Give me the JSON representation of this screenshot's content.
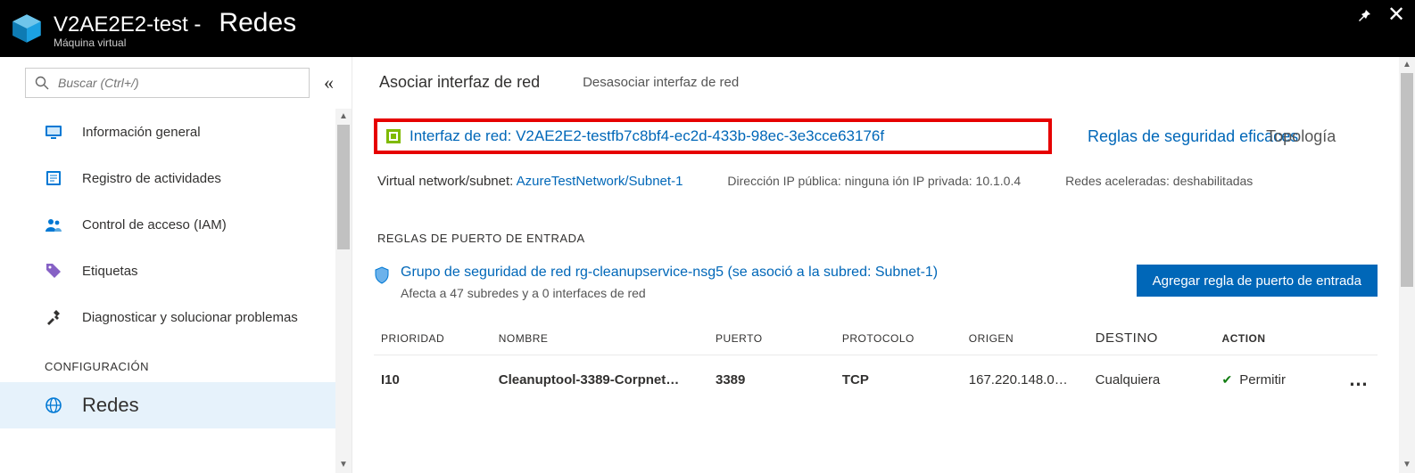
{
  "header": {
    "title_resource": "V2AE2E2-test -",
    "title_section": "Redes",
    "subtitle": "Máquina virtual"
  },
  "sidebar": {
    "search_placeholder": "Buscar (Ctrl+/)",
    "items": [
      {
        "label": "Información general",
        "icon": "monitor"
      },
      {
        "label": "Registro de actividades",
        "icon": "log"
      },
      {
        "label": "Control de acceso (IAM)",
        "icon": "people"
      },
      {
        "label": "Etiquetas",
        "icon": "tag"
      },
      {
        "label": "Diagnosticar y solucionar problemas",
        "icon": "tools"
      }
    ],
    "section_label": "CONFIGURACIÓN",
    "active_item": {
      "label": "Redes",
      "icon": "network"
    }
  },
  "tabs": {
    "associate": "Asociar interfaz de red",
    "dissociate": "Desasociar interfaz de red"
  },
  "nic": {
    "label": "Interfaz de red:",
    "name": "V2AE2E2-testfb7c8bf4-ec2d-433b-98ec-3e3cce63176f"
  },
  "right_links": {
    "effective_rules": "Reglas de seguridad eficaces",
    "topology": "Topología"
  },
  "info": {
    "vnet_label": "Virtual network/subnet:",
    "vnet_value": "AzureTestNetwork/Subnet-1",
    "public_ip_label": "Dirección IP pública:",
    "public_ip_value": "ninguna",
    "private_ip_label": "IP privada:",
    "private_ip_value": "10.1.0.4",
    "accel_label": "Redes  aceleradas:",
    "accel_value": "deshabilitadas"
  },
  "rules": {
    "section_title": "REGLAS DE PUERTO DE ENTRADA",
    "nsg_link": "Grupo de seguridad de red rg-cleanupservice-nsg5 (se asoció a la subred: Subnet-1)",
    "nsg_sub": "Afecta a 47 subredes y a 0 interfaces de red",
    "add_button": "Agregar regla de puerto de entrada",
    "columns": {
      "priority": "Prioridad",
      "name": "Nombre",
      "port": "Puerto",
      "protocol": "Protocolo",
      "source": "Origen",
      "destination": "Destino",
      "action": "Action"
    },
    "rows": [
      {
        "priority": "I10",
        "name": "Cleanuptool-3389-Corpnet…",
        "port": "3389",
        "protocol": "TCP",
        "source": "167.220.148.0…",
        "destination": "Cualquiera",
        "action": "Permitir"
      }
    ]
  }
}
